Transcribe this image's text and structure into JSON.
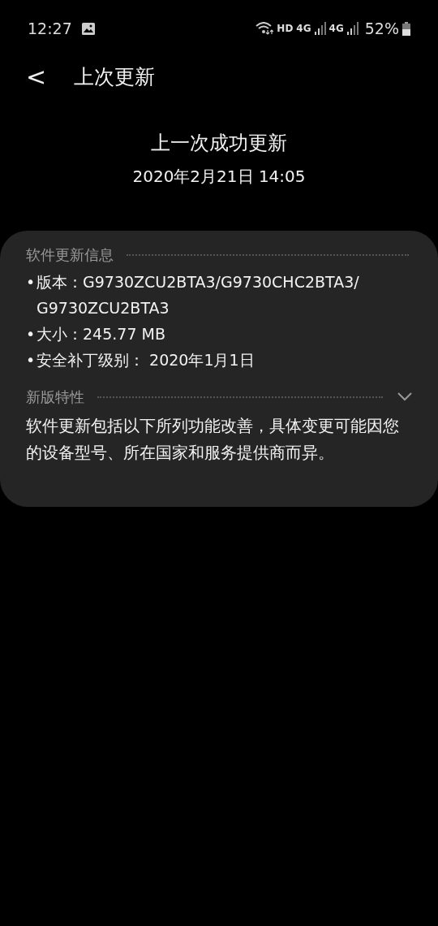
{
  "status_bar": {
    "time": "12:27",
    "network_labels": [
      "HD",
      "4G",
      "4G"
    ],
    "battery": "52%"
  },
  "header": {
    "back": "<",
    "title": "上次更新"
  },
  "summary": {
    "heading": "上一次成功更新",
    "date": "2020年2月21日 14:05"
  },
  "sections": [
    {
      "title": "软件更新信息",
      "kind": "list",
      "items": [
        {
          "bullet": "•",
          "label": "版本：",
          "value": "G9730ZCU2BTA3/G9730CHC2BTA3/G9730ZCU2BTA3"
        },
        {
          "bullet": "•",
          "label": "大小：",
          "value": "245.77 MB"
        },
        {
          "bullet": "•",
          "label": "安全补丁级别：",
          "value": " 2020年1月1日"
        }
      ]
    },
    {
      "title": "新版特性",
      "kind": "collapsible",
      "text": "软件更新包括以下所列功能改善，具体变更可能因您的设备型号、所在国家和服务提供商而异。"
    }
  ]
}
